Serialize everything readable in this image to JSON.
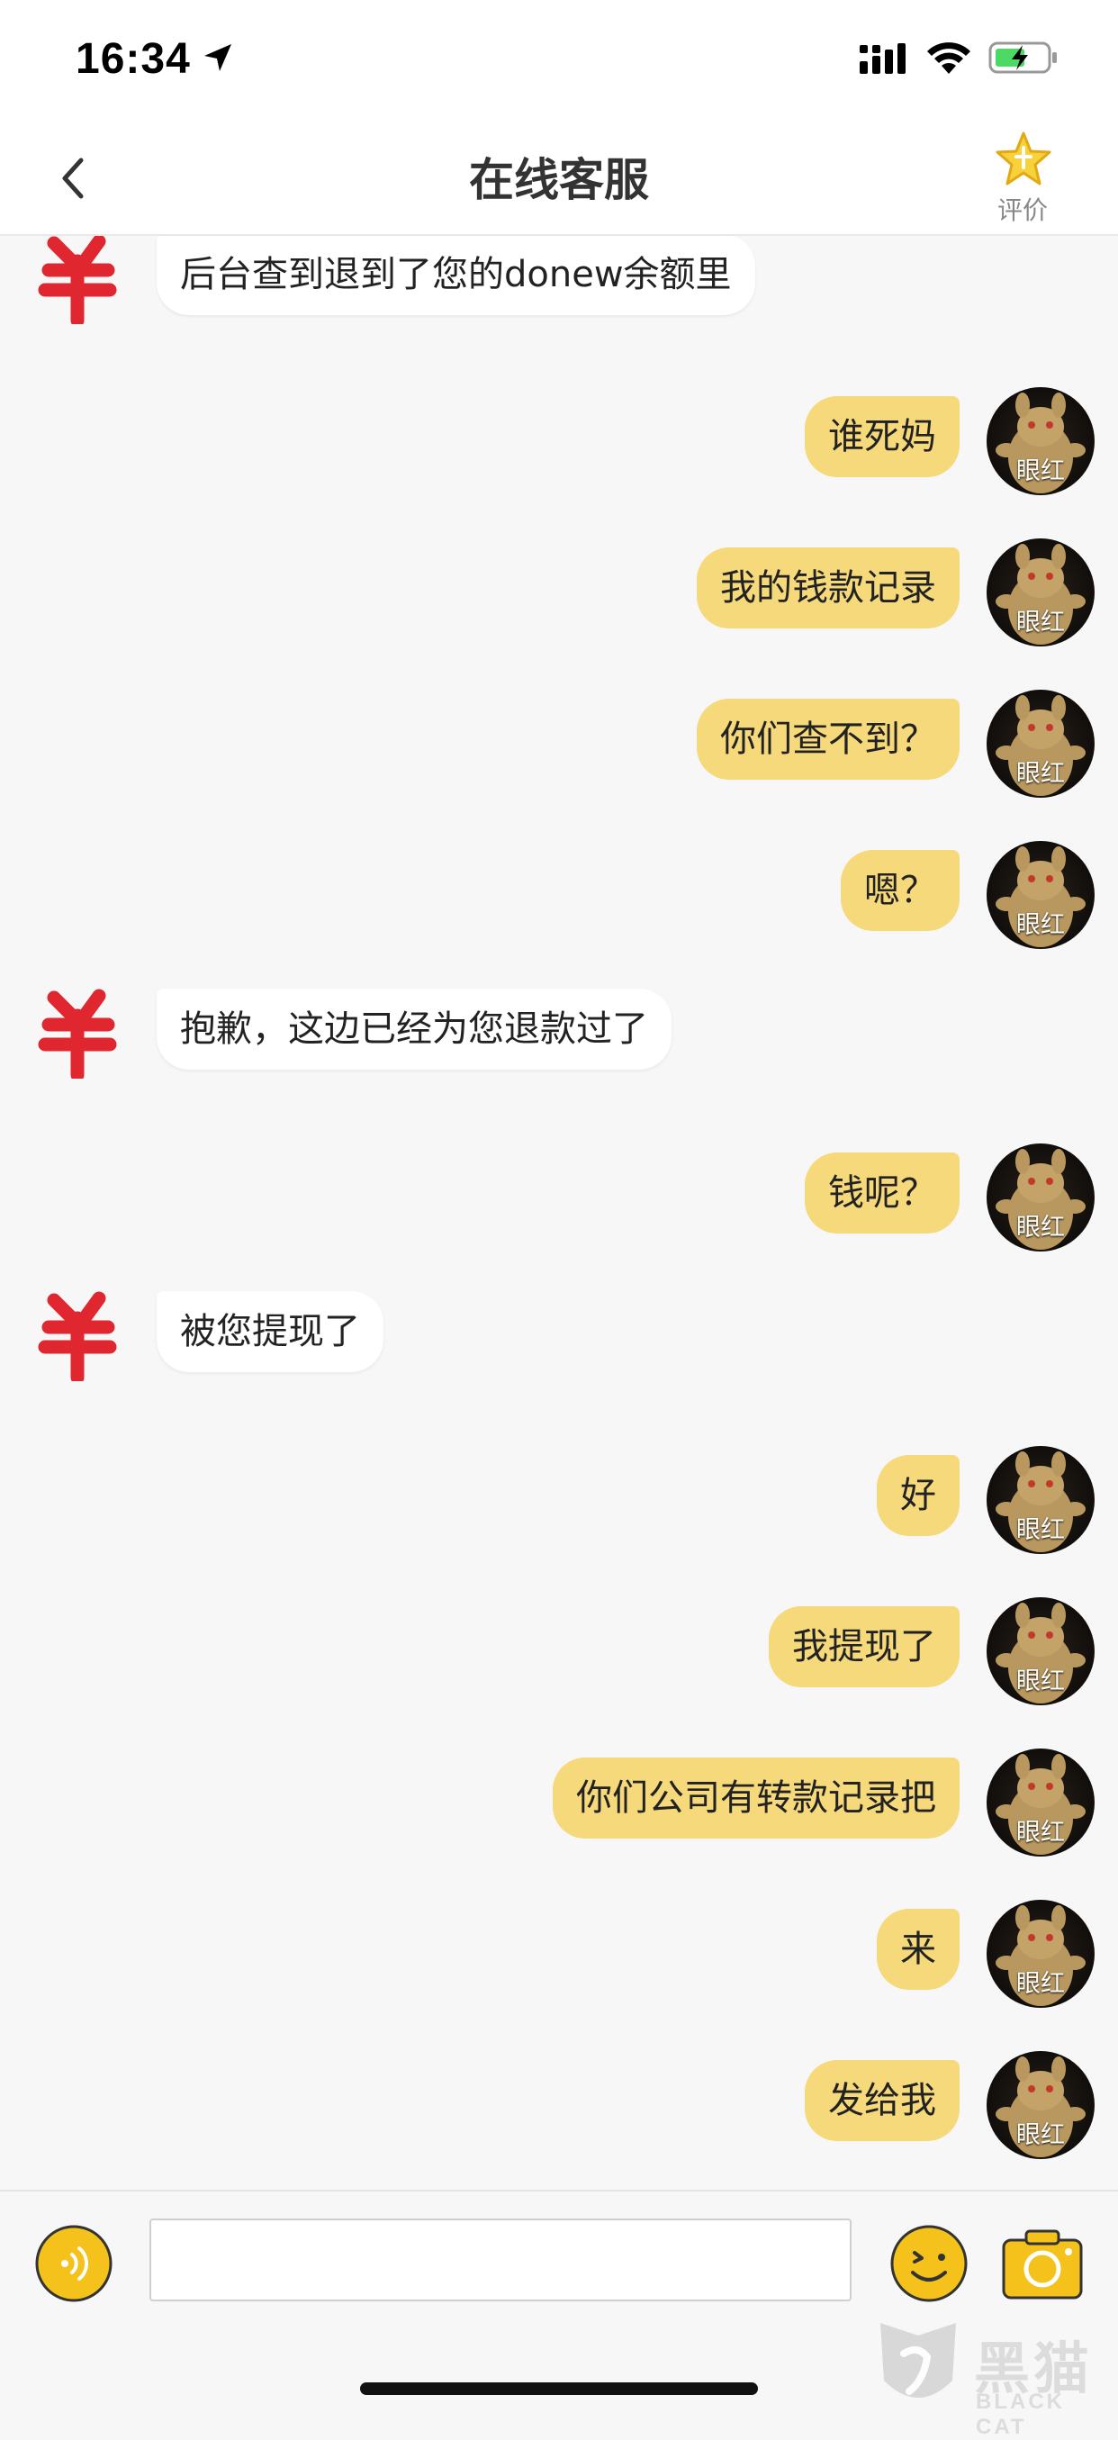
{
  "status_bar": {
    "time": "16:34"
  },
  "header": {
    "title": "在线客服",
    "rate_label": "评价"
  },
  "messages": [
    {
      "side": "agent",
      "text": "后台查到退到了您的donew余额里"
    },
    {
      "side": "user",
      "text": "谁死妈",
      "avatar_label": "眼红"
    },
    {
      "side": "user",
      "text": "我的钱款记录",
      "avatar_label": "眼红"
    },
    {
      "side": "user",
      "text": "你们查不到？",
      "avatar_label": "眼红"
    },
    {
      "side": "user",
      "text": "嗯？",
      "avatar_label": "眼红"
    },
    {
      "side": "agent",
      "text": "抱歉，这边已经为您退款过了"
    },
    {
      "side": "user",
      "text": "钱呢？",
      "avatar_label": "眼红"
    },
    {
      "side": "agent",
      "text": "被您提现了"
    },
    {
      "side": "user",
      "text": "好",
      "avatar_label": "眼红"
    },
    {
      "side": "user",
      "text": "我提现了",
      "avatar_label": "眼红"
    },
    {
      "side": "user",
      "text": "你们公司有转款记录把",
      "avatar_label": "眼红"
    },
    {
      "side": "user",
      "text": "来",
      "avatar_label": "眼红"
    },
    {
      "side": "user",
      "text": "发给我",
      "avatar_label": "眼红"
    }
  ],
  "input": {
    "value": "",
    "placeholder": ""
  },
  "watermark": {
    "text": "黑猫",
    "sub": "BLACK CAT"
  },
  "colors": {
    "user_bubble": "#f6d97b",
    "agent_bubble": "#ffffff",
    "accent": "#f5c21b",
    "agent_avatar": "#e0262e"
  }
}
